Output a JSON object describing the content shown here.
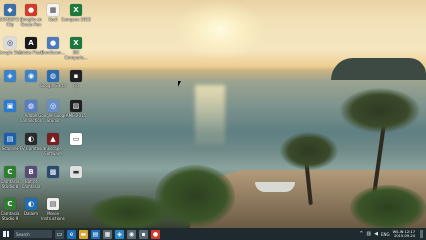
{
  "desktop_icons": [
    {
      "label": "GOM/GIF2 | Clip",
      "color": "#3a6fa8",
      "glyph": "◆"
    },
    {
      "label": "Giroglio en Greco Pen",
      "color": "#d23a2a",
      "glyph": "●"
    },
    {
      "label": "Kodi",
      "color": "#f3f3f3",
      "glyph": "▦"
    },
    {
      "label": "Compare 2015",
      "color": "#1e7a3c",
      "glyph": "X"
    },
    {
      "label": "Google Site",
      "color": "#d9dde0",
      "glyph": "◎"
    },
    {
      "label": "Adobe Flash",
      "color": "#1a1a1a",
      "glyph": "A"
    },
    {
      "label": "Bandicam...",
      "color": "#4a7abf",
      "glyph": "●"
    },
    {
      "label": "Bill Comparis...",
      "color": "#1e7a3c",
      "glyph": "X"
    },
    {
      "label": "",
      "color": "#3b82c8",
      "glyph": "◈"
    },
    {
      "label": "",
      "color": "#3b82c8",
      "glyph": "◉"
    },
    {
      "label": "Google Earth",
      "color": "#2b6cb0",
      "glyph": "◍"
    },
    {
      "label": "Pip",
      "color": "#222222",
      "glyph": "▪"
    },
    {
      "label": "",
      "color": "#2c7bd0",
      "glyph": "▣"
    },
    {
      "label": "Adobe Connection",
      "color": "#5a7ec2",
      "glyph": "◍"
    },
    {
      "label": "Google Google Studio",
      "color": "#6a8ec8",
      "glyph": "◎"
    },
    {
      "label": "AME 2015",
      "color": "#1f1f1f",
      "glyph": "▨"
    },
    {
      "label": "Scanner",
      "color": "#1d5fa8",
      "glyph": "▤"
    },
    {
      "label": "PFV Camtasia",
      "color": "#2a2a2a",
      "glyph": "◐"
    },
    {
      "label": "Inkscape Software",
      "color": "#7a1f1f",
      "glyph": "▲"
    },
    {
      "label": "",
      "color": "#ffffff",
      "glyph": "▭"
    },
    {
      "label": "Camtasia Studio 8",
      "color": "#2f7d32",
      "glyph": "C"
    },
    {
      "label": "Bat of Camtasia",
      "color": "#5a4a7a",
      "glyph": "B"
    },
    {
      "label": "",
      "color": "#2a4a70",
      "glyph": "▩"
    },
    {
      "label": "",
      "color": "#e0e0e0",
      "glyph": "▬"
    },
    {
      "label": "Camtasia Studio 9",
      "color": "#2f7d32",
      "glyph": "C"
    },
    {
      "label": "Dalaim",
      "color": "#1e6db8",
      "glyph": "◐"
    },
    {
      "label": "Movie Instructions",
      "color": "#f0f0f0",
      "glyph": "▤"
    }
  ],
  "taskbar": {
    "search_placeholder": "Search",
    "apps": [
      {
        "name": "task-view",
        "color": "#3a4a52",
        "glyph": "▭"
      },
      {
        "name": "edge",
        "color": "#1e6db8",
        "glyph": "e"
      },
      {
        "name": "file-explorer",
        "color": "#d9a52a",
        "glyph": "▬"
      },
      {
        "name": "store",
        "color": "#1e6db8",
        "glyph": "▤"
      },
      {
        "name": "app-1",
        "color": "#5a6a72",
        "glyph": "▦"
      },
      {
        "name": "app-2",
        "color": "#2a8ac8",
        "glyph": "◈"
      },
      {
        "name": "app-3",
        "color": "#5a6a72",
        "glyph": "◉"
      },
      {
        "name": "app-4",
        "color": "#5a6a72",
        "glyph": "▪"
      },
      {
        "name": "app-5",
        "color": "#d23a2a",
        "glyph": "●"
      }
    ],
    "tray": {
      "network_icon": "network-icon",
      "volume_icon": "volume-icon",
      "language": "ENG",
      "time": "WS-IN 12:17",
      "date": "2015-09-24"
    }
  }
}
